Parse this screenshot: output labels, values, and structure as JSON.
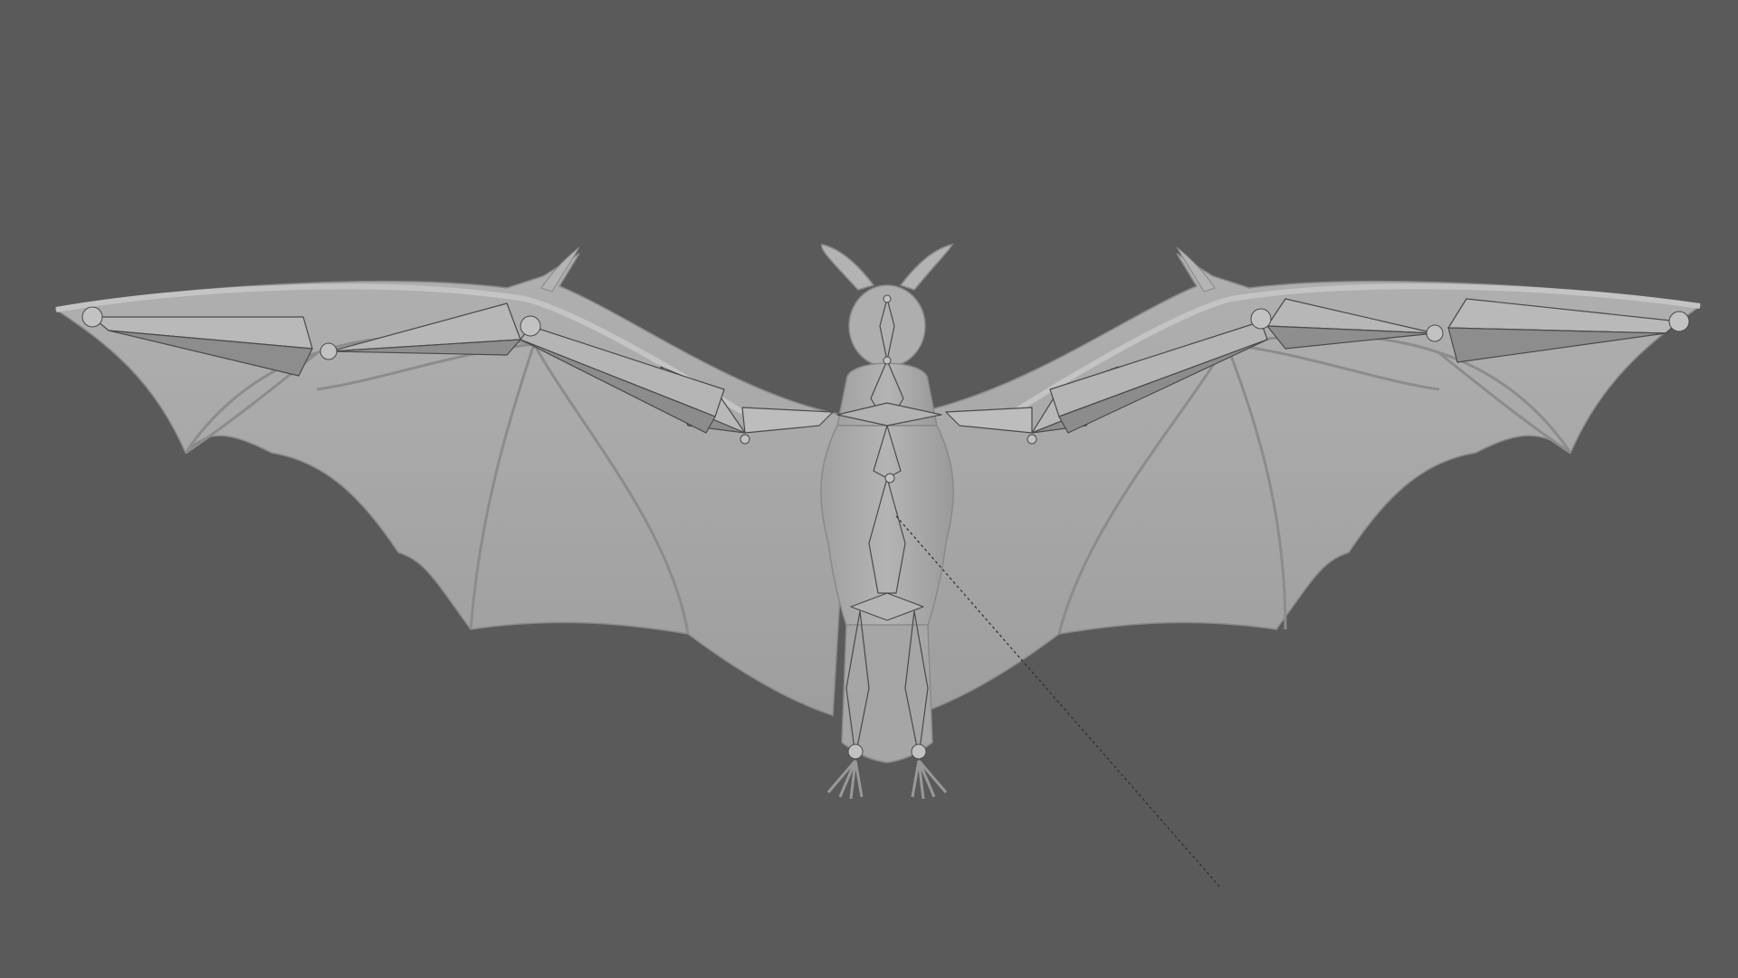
{
  "viewport": {
    "background": "#5a5a5a",
    "mesh_color": "#a8a8a8",
    "mesh_shadow": "#8f8f8f",
    "bone_color": "#b9b9b9",
    "bone_shade": "#8c8c8c",
    "bone_outline": "#4a4a4a"
  },
  "scene": {
    "model": "bat-mesh",
    "armature": "bat-armature",
    "relationship_line": "dashed"
  }
}
